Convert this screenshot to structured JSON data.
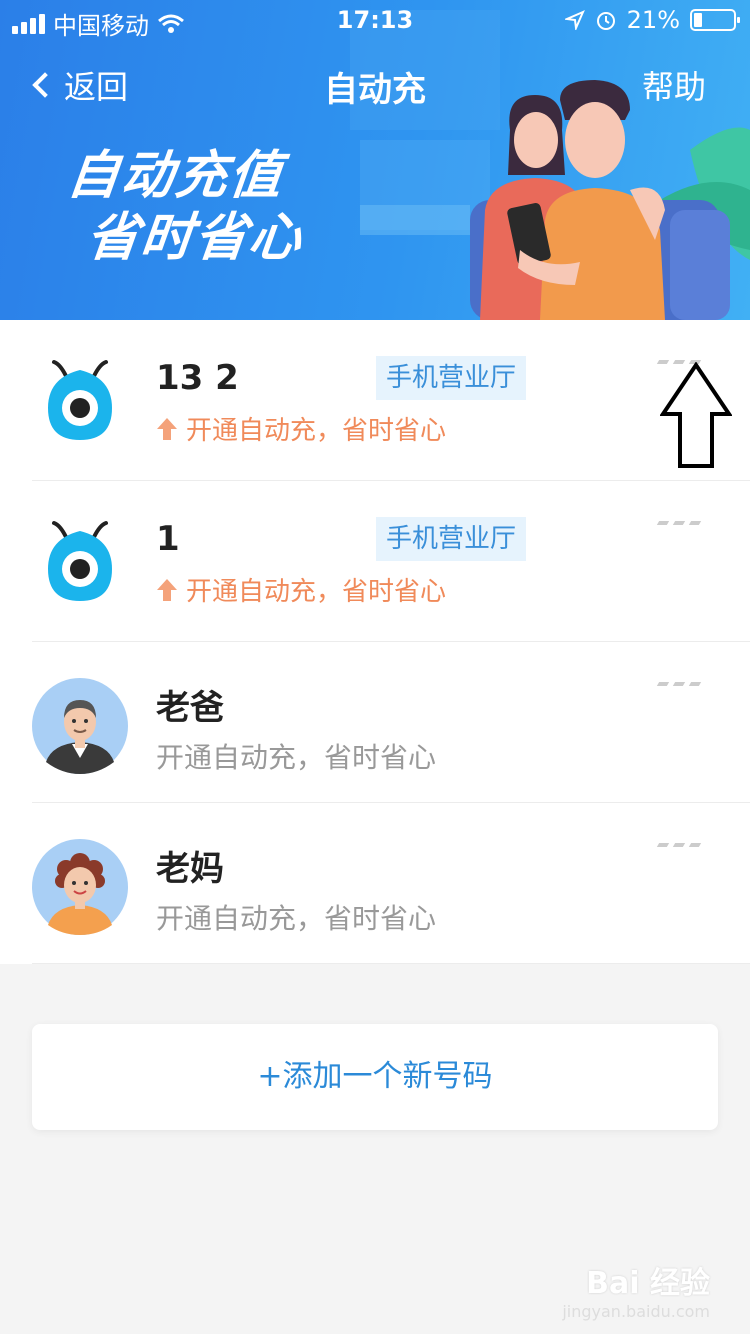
{
  "status_bar": {
    "carrier": "中国移动",
    "time": "17:13",
    "battery": "21%",
    "battery_level": 0.21
  },
  "nav": {
    "back_label": "返回",
    "title": "自动充",
    "help_label": "帮助"
  },
  "banner": {
    "slogan_line1": "自动充值",
    "slogan_line2": "省时省心"
  },
  "accounts": [
    {
      "number": "13                    2",
      "tag": "手机营业厅",
      "subtitle": "开通自动充，省时省心",
      "avatar_icon": "app-mascot-icon"
    },
    {
      "number": "1",
      "tag": "手机营业厅",
      "subtitle": "开通自动充，省时省心",
      "avatar_icon": "app-mascot-icon"
    },
    {
      "name": "老爸",
      "subtitle": "开通自动充，省时省心",
      "avatar_icon": "dad-avatar-icon"
    },
    {
      "name": "老妈",
      "subtitle": "开通自动充，省时省心",
      "avatar_icon": "mom-avatar-icon"
    }
  ],
  "add_button_label": "+添加一个新号码",
  "watermark": {
    "line1": "Bai 经验",
    "line2": "jingyan.baidu.com"
  },
  "colors": {
    "header_start": "#2b7fe8",
    "accent_blue": "#2b8ad8",
    "promo_orange": "#f08a5a",
    "tag_bg": "#e6f3fd"
  }
}
